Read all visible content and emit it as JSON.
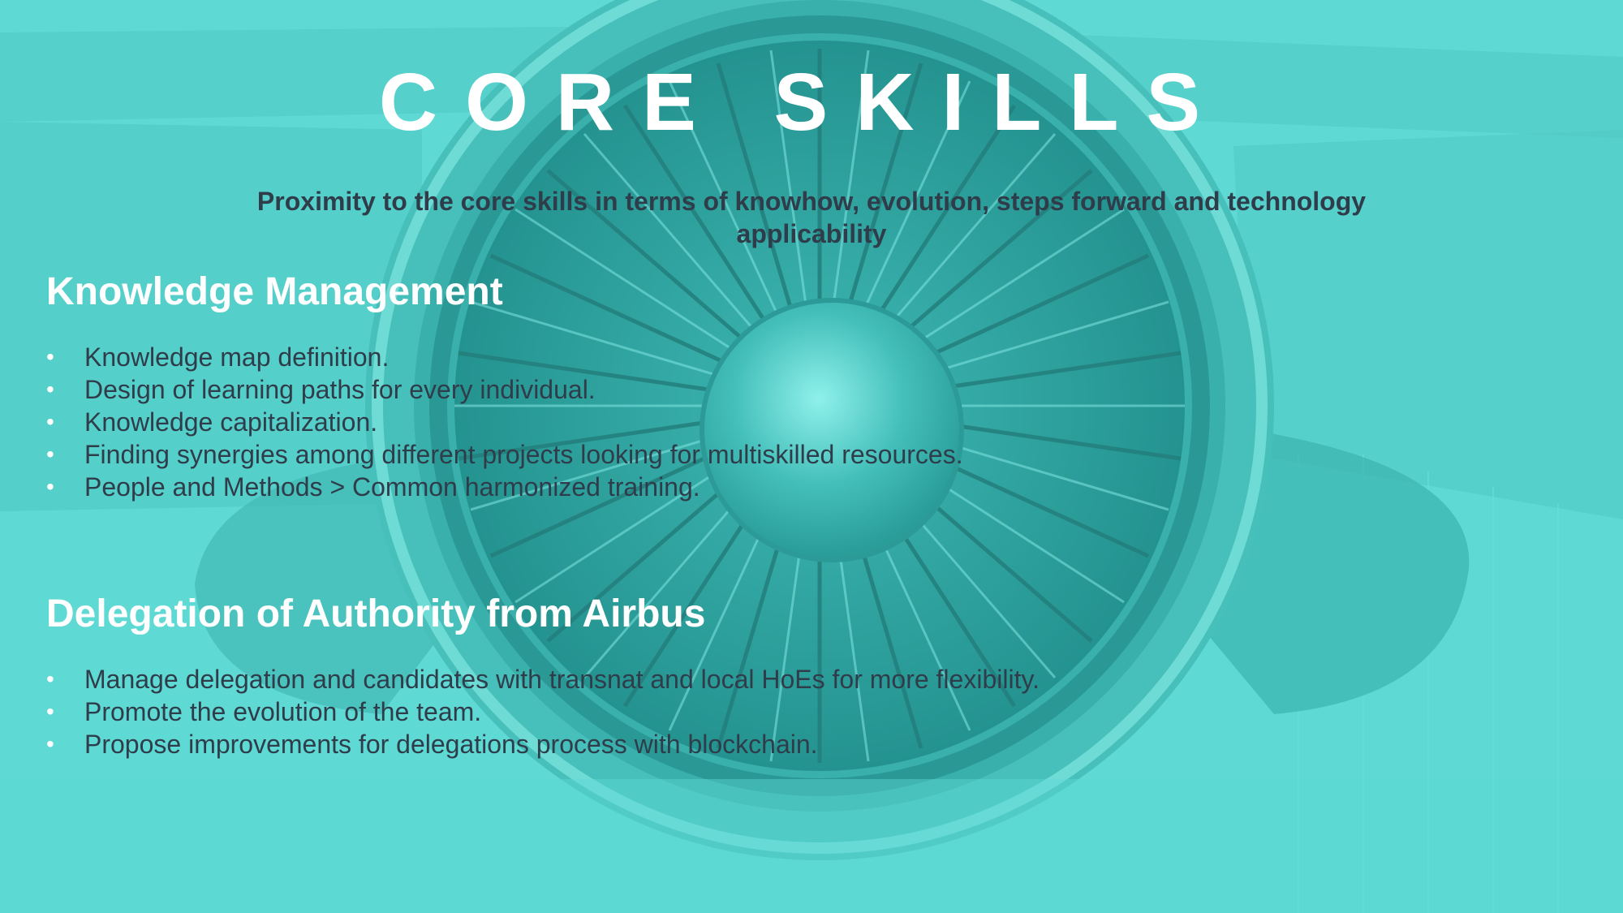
{
  "colors": {
    "background": "#5ed9d4",
    "title_text": "#ffffff",
    "body_text": "#2f3d4a",
    "bullet_marker": "#ffffff"
  },
  "background_image": {
    "icon": "jet-engine-illustration"
  },
  "slide": {
    "title": "CORE SKILLS",
    "subtitle": "Proximity to the core skills in terms of knowhow, evolution, steps forward and technology applicability",
    "bullet_glyph": "•",
    "sections": [
      {
        "heading": "Knowledge Management",
        "items": [
          "Knowledge map definition.",
          "Design of learning paths for every individual.",
          "Knowledge capitalization.",
          "Finding synergies among different projects looking for multiskilled resources.",
          "People and Methods > Common harmonized training."
        ]
      },
      {
        "heading": "Delegation of Authority from Airbus",
        "items": [
          "Manage delegation and candidates with transnat and local HoEs for more flexibility.",
          "Promote the evolution of the team.",
          "Propose improvements for delegations process with blockchain."
        ]
      }
    ]
  }
}
